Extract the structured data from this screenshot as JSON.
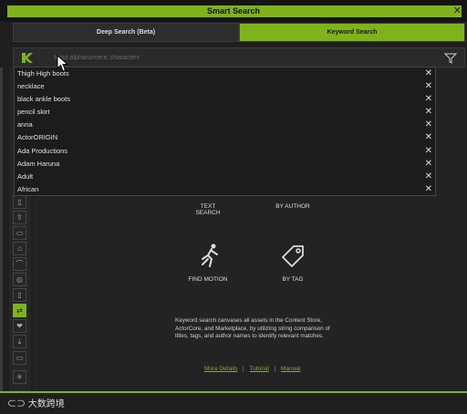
{
  "window": {
    "title": "Smart Search",
    "close_icon": "close-icon"
  },
  "tabs": [
    {
      "label": "Deep Search (Beta)",
      "active": false
    },
    {
      "label": "Keyword Search",
      "active": true
    }
  ],
  "search": {
    "placeholder": "Input alphanumeric characters",
    "value": ""
  },
  "history": [
    "Thigh High boots",
    "necklace",
    "black ankle boots",
    "pencil skirt",
    "anna",
    "ActorORIGIN",
    "Ada Productions",
    "Adam Haruna",
    "Adult",
    "African"
  ],
  "options": {
    "text_search": "TEXT\nSEARCH",
    "by_author": "BY AUTHOR",
    "find_motion": "FIND MOTION",
    "by_tag": "BY TAG"
  },
  "description": "Keyword search canvases all assets in the Content Store, ActorCore, and Marketplace, by utilizing string comparison of titles, tags, and author names to identify relevant matches.",
  "links": {
    "more_details": "More Details",
    "tutorial": "Tutorial",
    "manual": "Manual"
  },
  "watermark": "大数跨境",
  "colors": {
    "accent": "#7fb31e",
    "background": "#1f1f1f"
  }
}
